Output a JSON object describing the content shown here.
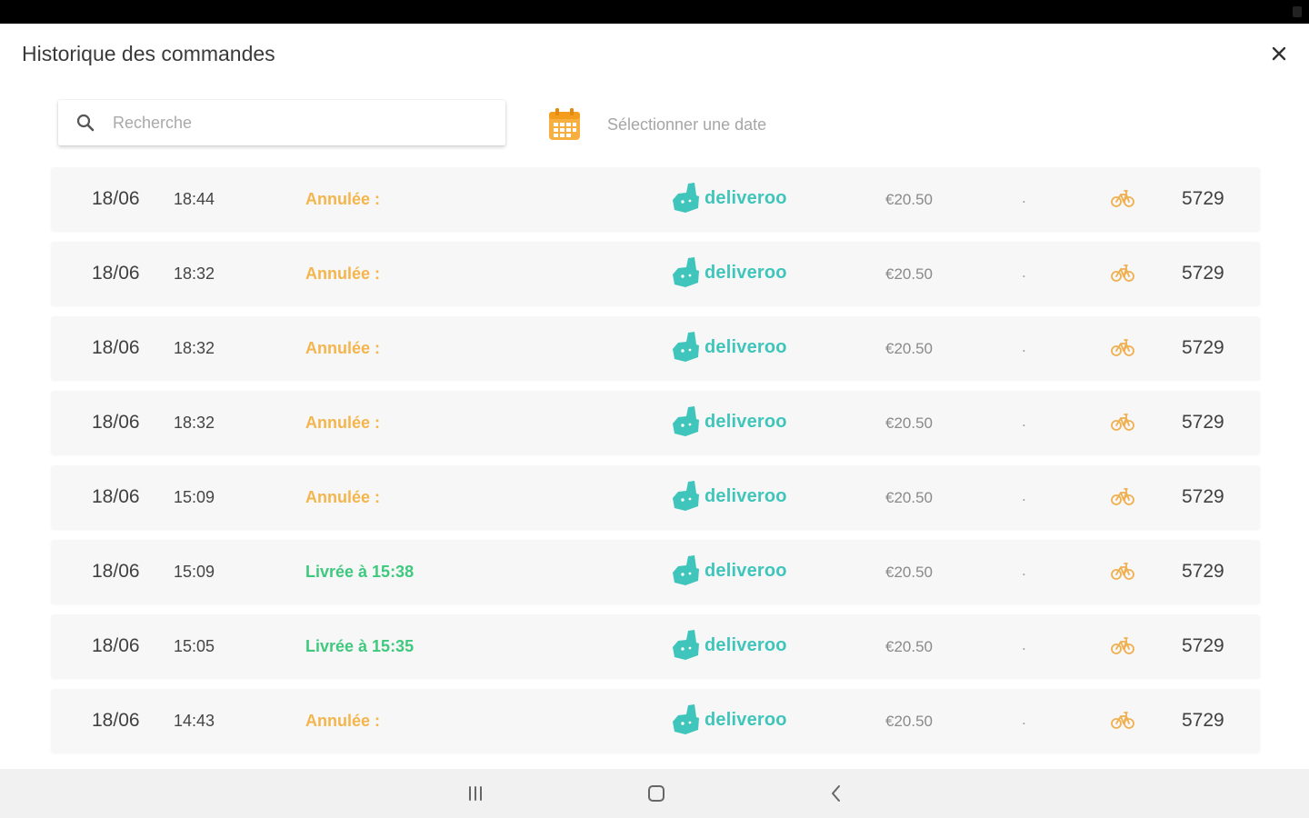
{
  "header": {
    "title": "Historique des commandes"
  },
  "search": {
    "placeholder": "Recherche",
    "value": ""
  },
  "date_filter": {
    "label": "Sélectionner une date"
  },
  "colors": {
    "cancelled": "#f3b54c",
    "delivered": "#3ec97e",
    "deliveroo": "#3fc5bb",
    "accent": "#f7b040"
  },
  "icons": {
    "close": "close-icon",
    "search": "search-icon",
    "calendar": "calendar-icon",
    "provider": "deliveroo-icon",
    "vehicle": "bicycle-icon"
  },
  "orders": [
    {
      "date": "18/06",
      "time": "18:44",
      "status": "Annulée :",
      "status_type": "cancelled",
      "provider": "deliveroo",
      "price": "€20.50",
      "separator": ".",
      "number": "5729"
    },
    {
      "date": "18/06",
      "time": "18:32",
      "status": "Annulée :",
      "status_type": "cancelled",
      "provider": "deliveroo",
      "price": "€20.50",
      "separator": ".",
      "number": "5729"
    },
    {
      "date": "18/06",
      "time": "18:32",
      "status": "Annulée :",
      "status_type": "cancelled",
      "provider": "deliveroo",
      "price": "€20.50",
      "separator": ".",
      "number": "5729"
    },
    {
      "date": "18/06",
      "time": "18:32",
      "status": "Annulée :",
      "status_type": "cancelled",
      "provider": "deliveroo",
      "price": "€20.50",
      "separator": ".",
      "number": "5729"
    },
    {
      "date": "18/06",
      "time": "15:09",
      "status": "Annulée :",
      "status_type": "cancelled",
      "provider": "deliveroo",
      "price": "€20.50",
      "separator": ".",
      "number": "5729"
    },
    {
      "date": "18/06",
      "time": "15:09",
      "status": "Livrée à 15:38",
      "status_type": "delivered",
      "provider": "deliveroo",
      "price": "€20.50",
      "separator": ".",
      "number": "5729"
    },
    {
      "date": "18/06",
      "time": "15:05",
      "status": "Livrée à 15:35",
      "status_type": "delivered",
      "provider": "deliveroo",
      "price": "€20.50",
      "separator": ".",
      "number": "5729"
    },
    {
      "date": "18/06",
      "time": "14:43",
      "status": "Annulée :",
      "status_type": "cancelled",
      "provider": "deliveroo",
      "price": "€20.50",
      "separator": ".",
      "number": "5729"
    }
  ],
  "nav": {
    "recent": "recent-apps-icon",
    "home": "home-icon",
    "back": "back-icon"
  }
}
